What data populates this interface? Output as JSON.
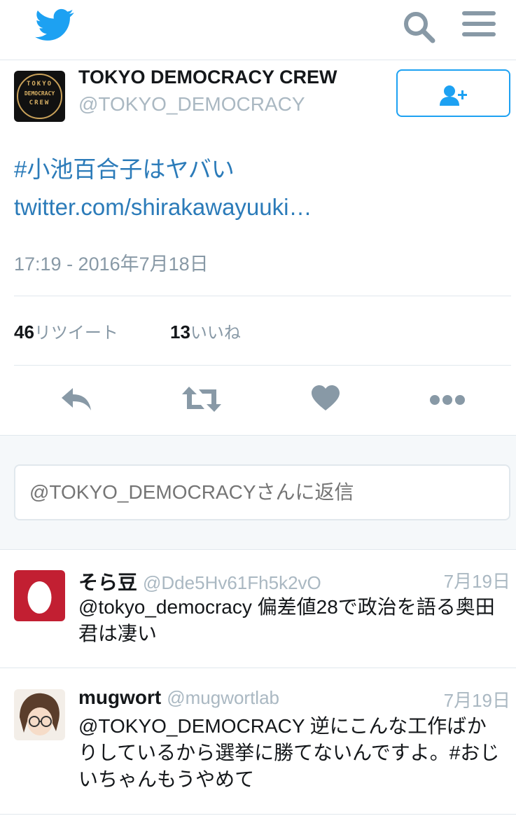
{
  "header": {
    "logo_icon": "twitter-bird-icon",
    "search_icon": "search-icon",
    "menu_icon": "hamburger-menu-icon",
    "brand_color": "#1da1f2"
  },
  "tweet": {
    "avatar_text": [
      "TOKYO",
      "DEMOCRACY",
      "CREW"
    ],
    "display_name": "TOKYO DEMOCRACY CREW",
    "screen_name": "@TOKYO_DEMOCRACY",
    "follow_icon": "add-user-icon",
    "hashtag": "#小池百合子はヤバい",
    "link": "twitter.com/shirakawayuuki…",
    "timestamp": "17:19 - 2016年7月18日",
    "retweet_count": "46",
    "retweet_label": "リツイート",
    "like_count": "13",
    "like_label": "いいね",
    "link_color": "#2b7bb9"
  },
  "reply_box": {
    "placeholder": "@TOKYO_DEMOCRACYさんに返信"
  },
  "replies": [
    {
      "name": "そら豆",
      "handle": "@Dde5Hv61Fh5k2vO",
      "date": "7月19日",
      "text": "@tokyo_democracy 偏差値28で政治を語る奥田君は凄い"
    },
    {
      "name": "mugwort",
      "handle": "@mugwortlab",
      "date": "7月19日",
      "text": "@TOKYO_DEMOCRACY 逆にこんな工作ばかりしているから選挙に勝てないんですよ。#おじいちゃんもうやめて"
    }
  ]
}
